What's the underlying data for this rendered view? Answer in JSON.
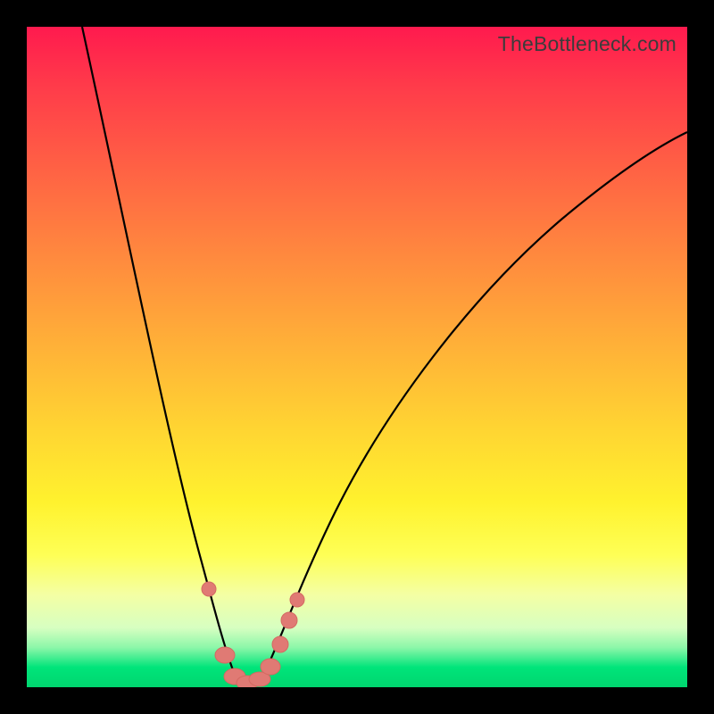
{
  "watermark": "TheBottleneck.com",
  "chart_data": {
    "type": "line",
    "title": "",
    "xlabel": "",
    "ylabel": "",
    "xlim": [
      0,
      100
    ],
    "ylim": [
      0,
      100
    ],
    "x": [
      8,
      10,
      12,
      14,
      16,
      18,
      20,
      22,
      24,
      25,
      26,
      27,
      28,
      29,
      30,
      31,
      32,
      33,
      34,
      35,
      37,
      40,
      45,
      50,
      55,
      60,
      65,
      70,
      75,
      80,
      85,
      90,
      95,
      100
    ],
    "values": [
      100,
      93,
      86,
      79,
      71,
      63,
      55,
      46,
      36,
      30,
      24,
      18,
      12,
      7,
      3,
      1,
      0,
      0,
      1,
      3,
      8,
      15,
      25,
      33,
      40,
      46,
      52,
      57,
      62,
      66,
      70,
      74,
      77,
      80
    ],
    "series": [
      {
        "name": "bottleneck-curve",
        "type": "line"
      },
      {
        "name": "highlight-markers",
        "type": "scatter",
        "x": [
          27,
          30,
          31,
          32,
          33,
          34,
          35,
          37,
          38
        ],
        "values": [
          17,
          2,
          0.5,
          0,
          0,
          0.5,
          2,
          8,
          11
        ]
      }
    ]
  },
  "colors": {
    "curve": "#000000",
    "marker_fill": "#e07a74",
    "marker_stroke": "#d46a62"
  }
}
